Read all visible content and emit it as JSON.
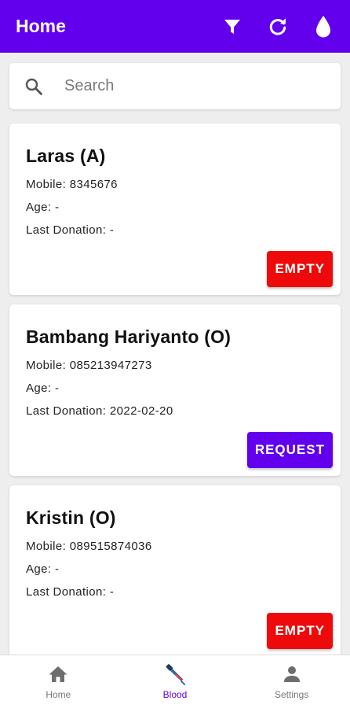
{
  "appbar": {
    "title": "Home",
    "icons": [
      "filter-icon",
      "refresh-icon",
      "blood-drop-icon"
    ],
    "color": "#6200ee"
  },
  "search": {
    "placeholder": "Search",
    "value": ""
  },
  "donors": [
    {
      "name": "Laras (A)",
      "mobile": "Mobile: 8345676",
      "age": "Age: -",
      "last_donation": "Last Donation: -",
      "action": "EMPTY",
      "action_color": "#ee0a0a"
    },
    {
      "name": "Bambang Hariyanto (O)",
      "mobile": "Mobile: 085213947273",
      "age": "Age: -",
      "last_donation": "Last Donation: 2022-02-20",
      "action": "REQUEST",
      "action_color": "#6200ee"
    },
    {
      "name": "Kristin (O)",
      "mobile": "Mobile: 089515874036",
      "age": "Age: -",
      "last_donation": "Last Donation: -",
      "action": "EMPTY",
      "action_color": "#ee0a0a"
    }
  ],
  "bottomnav": {
    "items": [
      {
        "label": "Home",
        "icon": "home-icon",
        "active": false
      },
      {
        "label": "Blood",
        "icon": "blood-dropper-icon",
        "active": true
      },
      {
        "label": "Settings",
        "icon": "person-icon",
        "active": false
      }
    ],
    "active_color": "#6200ee",
    "inactive_color": "#777777"
  }
}
